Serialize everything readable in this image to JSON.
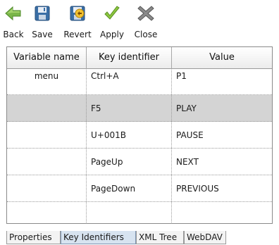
{
  "toolbar": {
    "back": {
      "label": "Back",
      "icon": "arrow-left-icon"
    },
    "save": {
      "label": "Save",
      "icon": "floppy-disk-icon"
    },
    "revert": {
      "label": "Revert",
      "icon": "revert-icon"
    },
    "apply": {
      "label": "Apply",
      "icon": "checkmark-icon"
    },
    "close": {
      "label": "Close",
      "icon": "close-x-icon"
    }
  },
  "table": {
    "columns": [
      "Variable name",
      "Key identifier",
      "Value"
    ],
    "rows": [
      {
        "variable": "menu",
        "key": "Ctrl+A",
        "value": "P1",
        "selected": false
      },
      {
        "variable": "",
        "key": "F5",
        "value": "PLAY",
        "selected": true
      },
      {
        "variable": "",
        "key": "U+001B",
        "value": "PAUSE",
        "selected": false
      },
      {
        "variable": "",
        "key": "PageUp",
        "value": "NEXT",
        "selected": false
      },
      {
        "variable": "",
        "key": "PageDown",
        "value": "PREVIOUS",
        "selected": false
      },
      {
        "variable": "",
        "key": "",
        "value": "",
        "selected": false
      }
    ]
  },
  "tabs": [
    {
      "label": "Properties",
      "active": false
    },
    {
      "label": "Key Identifiers",
      "active": true
    },
    {
      "label": "XML Tree",
      "active": false
    },
    {
      "label": "WebDAV",
      "active": false
    }
  ],
  "colors": {
    "back_arrow": "#7ab648",
    "save_disk": "#3a6ea5",
    "apply_check": "#8cc63f",
    "close_x": "#707070",
    "selected_row": "#d4d4d4"
  }
}
